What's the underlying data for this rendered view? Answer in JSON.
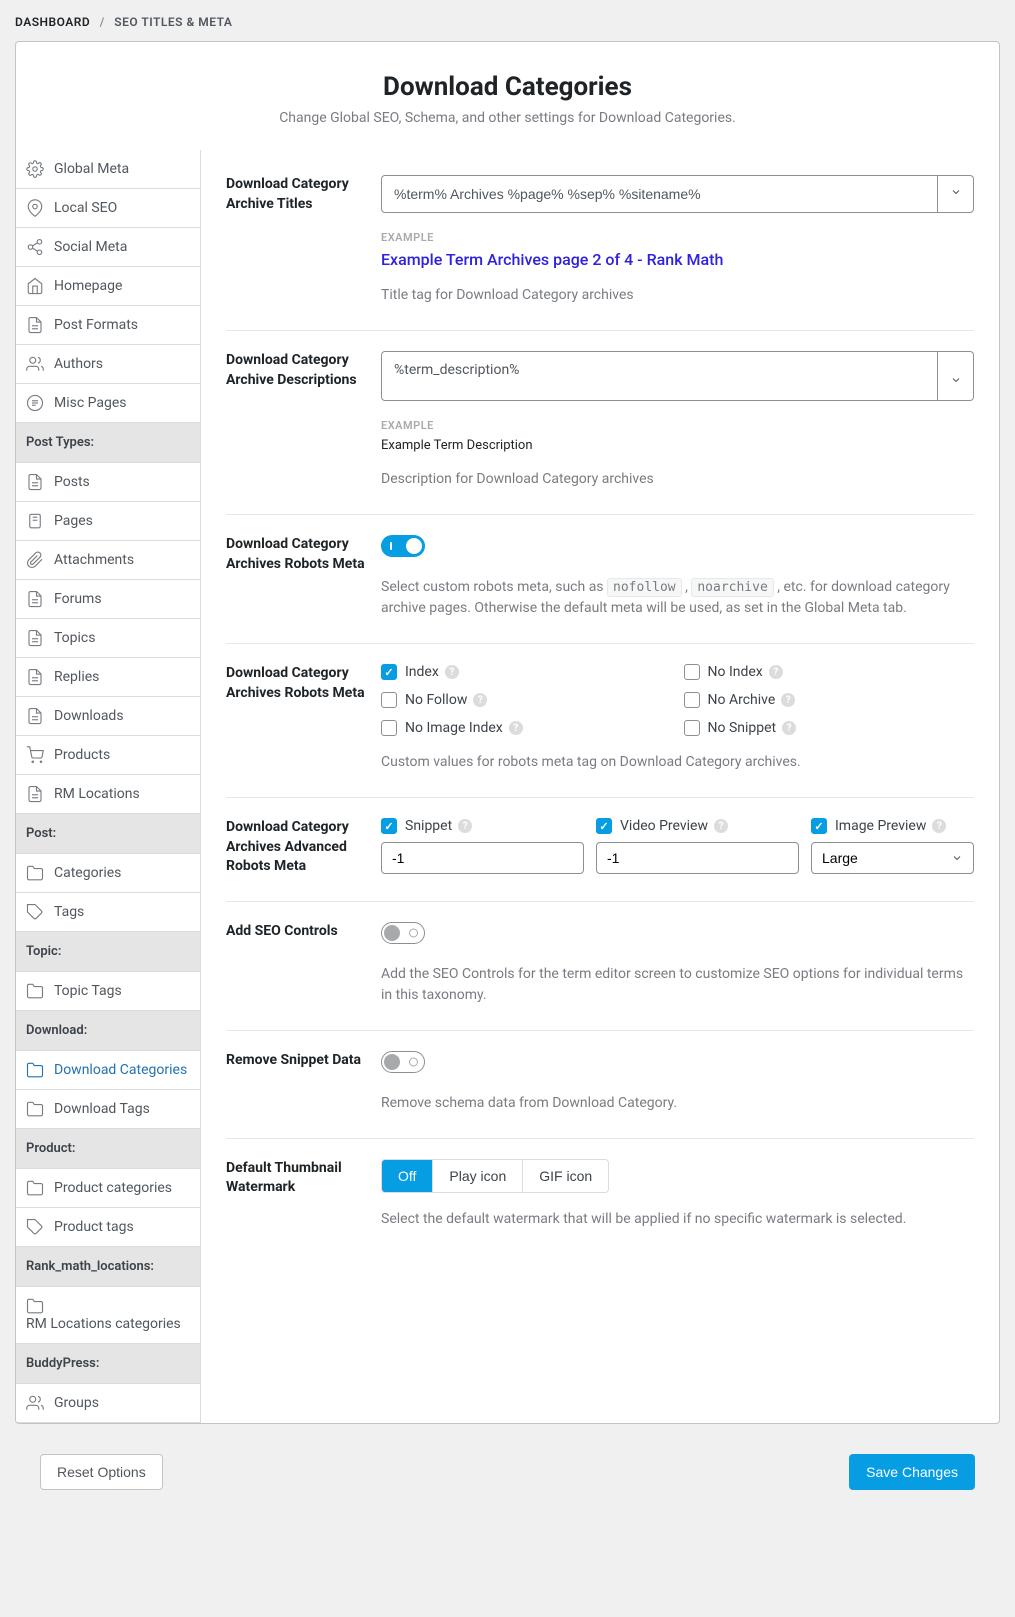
{
  "breadcrumb": {
    "dashboard": "DASHBOARD",
    "current": "SEO TITLES & META"
  },
  "header": {
    "title": "Download Categories",
    "subtitle": "Change Global SEO, Schema, and other settings for Download Categories."
  },
  "sidebar": {
    "top": [
      {
        "label": "Global Meta",
        "icon": "gear-icon"
      },
      {
        "label": "Local SEO",
        "icon": "pin-icon"
      },
      {
        "label": "Social Meta",
        "icon": "share-icon"
      },
      {
        "label": "Homepage",
        "icon": "home-icon"
      },
      {
        "label": "Post Formats",
        "icon": "doc-icon"
      },
      {
        "label": "Authors",
        "icon": "users-icon"
      },
      {
        "label": "Misc Pages",
        "icon": "list-icon"
      }
    ],
    "sections": [
      {
        "heading": "Post Types:",
        "items": [
          {
            "label": "Posts",
            "icon": "doc-icon"
          },
          {
            "label": "Pages",
            "icon": "page-icon"
          },
          {
            "label": "Attachments",
            "icon": "clip-icon"
          },
          {
            "label": "Forums",
            "icon": "doc-icon"
          },
          {
            "label": "Topics",
            "icon": "doc-icon"
          },
          {
            "label": "Replies",
            "icon": "doc-icon"
          },
          {
            "label": "Downloads",
            "icon": "doc-icon"
          },
          {
            "label": "Products",
            "icon": "cart-icon"
          },
          {
            "label": "RM Locations",
            "icon": "doc-icon"
          }
        ]
      },
      {
        "heading": "Post:",
        "items": [
          {
            "label": "Categories",
            "icon": "folder-icon"
          },
          {
            "label": "Tags",
            "icon": "tag-icon"
          }
        ]
      },
      {
        "heading": "Topic:",
        "items": [
          {
            "label": "Topic Tags",
            "icon": "folder-icon"
          }
        ]
      },
      {
        "heading": "Download:",
        "items": [
          {
            "label": "Download Categories",
            "icon": "folder-icon",
            "active": true
          },
          {
            "label": "Download Tags",
            "icon": "folder-icon"
          }
        ]
      },
      {
        "heading": "Product:",
        "items": [
          {
            "label": "Product categories",
            "icon": "folder-icon"
          },
          {
            "label": "Product tags",
            "icon": "tag-icon"
          }
        ]
      },
      {
        "heading": "Rank_math_locations:",
        "items": [
          {
            "label": "RM Locations categories",
            "icon": "folder-icon"
          }
        ]
      },
      {
        "heading": "BuddyPress:",
        "items": [
          {
            "label": "Groups",
            "icon": "users-icon"
          }
        ]
      }
    ]
  },
  "fields": {
    "archive_titles": {
      "label": "Download Category Archive Titles",
      "value": "%term% Archives %page% %sep% %sitename%",
      "example_label": "EXAMPLE",
      "example": "Example Term Archives page 2 of 4 - Rank Math",
      "help": "Title tag for Download Category archives"
    },
    "archive_desc": {
      "label": "Download Category Archive Descriptions",
      "value": "%term_description%",
      "example_label": "EXAMPLE",
      "example": "Example Term Description",
      "help": "Description for Download Category archives"
    },
    "robots_toggle": {
      "label": "Download Category Archives Robots Meta",
      "help_pre": "Select custom robots meta, such as ",
      "code1": "nofollow",
      "code2": "noarchive",
      "help_post": " , etc. for download category archive pages. Otherwise the default meta will be used, as set in the Global Meta tab."
    },
    "robots_meta": {
      "label": "Download Category Archives Robots Meta",
      "options": [
        {
          "label": "Index",
          "checked": true
        },
        {
          "label": "No Index",
          "checked": false
        },
        {
          "label": "No Follow",
          "checked": false
        },
        {
          "label": "No Archive",
          "checked": false
        },
        {
          "label": "No Image Index",
          "checked": false
        },
        {
          "label": "No Snippet",
          "checked": false
        }
      ],
      "help": "Custom values for robots meta tag on Download Category archives."
    },
    "advanced_robots": {
      "label": "Download Category Archives Advanced Robots Meta",
      "cols": [
        {
          "label": "Snippet",
          "checked": true,
          "value": "-1",
          "type": "text"
        },
        {
          "label": "Video Preview",
          "checked": true,
          "value": "-1",
          "type": "text"
        },
        {
          "label": "Image Preview",
          "checked": true,
          "value": "Large",
          "type": "select"
        }
      ]
    },
    "seo_controls": {
      "label": "Add SEO Controls",
      "help": "Add the SEO Controls for the term editor screen to customize SEO options for individual terms in this taxonomy."
    },
    "remove_snippet": {
      "label": "Remove Snippet Data",
      "help": "Remove schema data from Download Category."
    },
    "watermark": {
      "label": "Default Thumbnail Watermark",
      "options": [
        "Off",
        "Play icon",
        "GIF icon"
      ],
      "active": "Off",
      "help": "Select the default watermark that will be applied if no specific watermark is selected."
    }
  },
  "footer": {
    "reset": "Reset Options",
    "save": "Save Changes"
  }
}
